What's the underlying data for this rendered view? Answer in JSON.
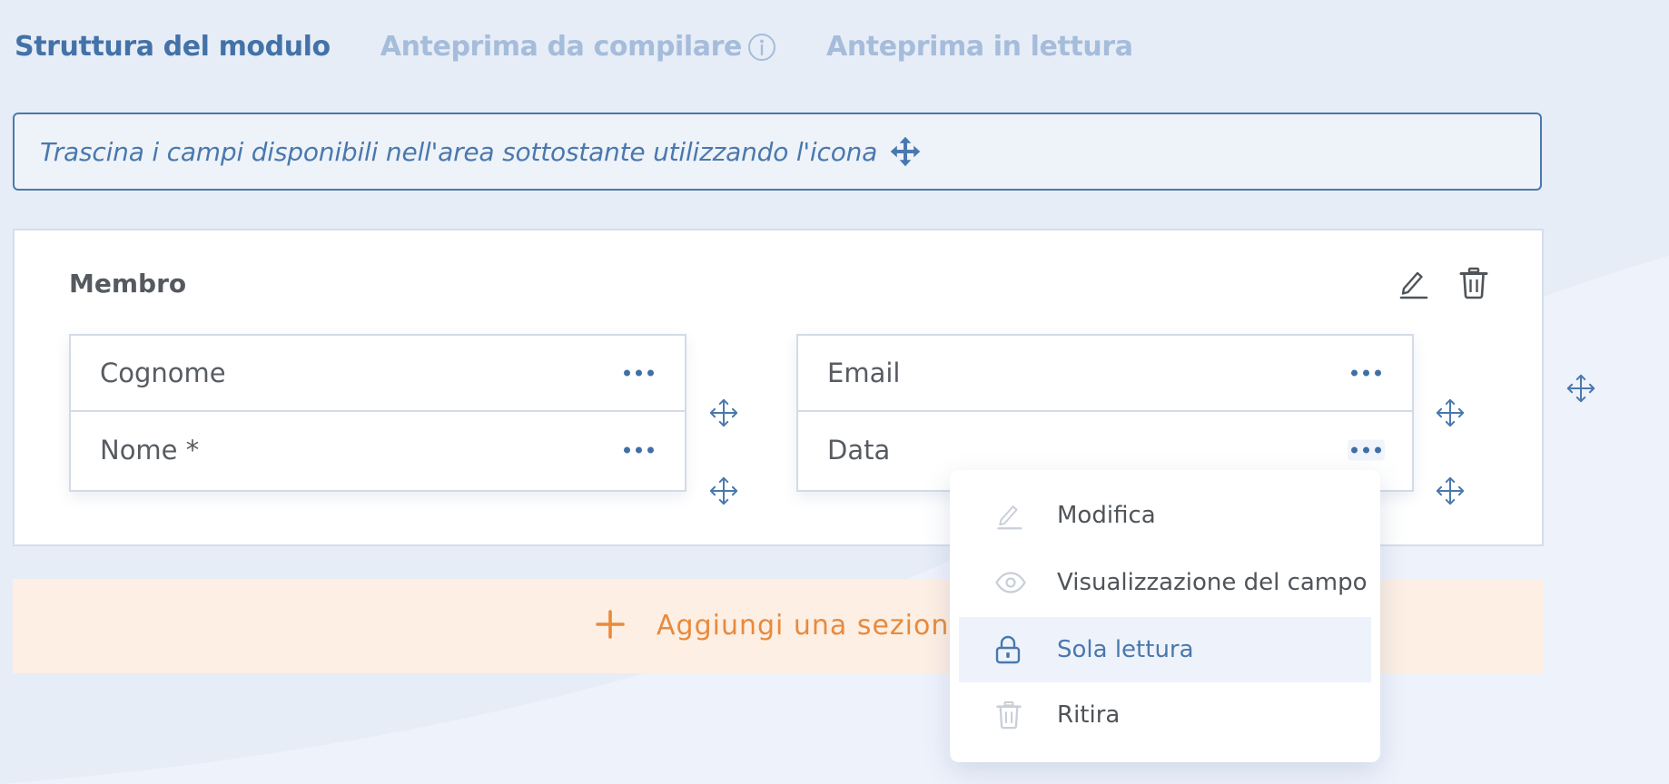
{
  "tabs": [
    {
      "label": "Struttura del modulo",
      "active": true
    },
    {
      "label": "Anteprima da compilare",
      "active": false
    },
    {
      "label": "Anteprima in lettura",
      "active": false
    }
  ],
  "hint": {
    "text": "Trascina i campi disponibili nell'area sottostante utilizzando l'icona",
    "icon": "move-icon"
  },
  "section": {
    "title": "Membro",
    "actions": [
      {
        "icon": "pencil-icon"
      },
      {
        "icon": "trash-icon"
      }
    ],
    "columns": [
      {
        "fields": [
          {
            "label": "Cognome"
          },
          {
            "label": "Nome *"
          }
        ]
      },
      {
        "fields": [
          {
            "label": "Email"
          },
          {
            "label": "Data"
          }
        ]
      }
    ]
  },
  "add_section": {
    "label": "Aggiungi una sezione",
    "icon": "plus-icon"
  },
  "context_menu": {
    "items": [
      {
        "label": "Modifica",
        "icon": "pencil-icon"
      },
      {
        "label": "Visualizzazione del campo",
        "icon": "eye-icon"
      },
      {
        "label": "Sola lettura",
        "icon": "lock-icon",
        "selected": true
      },
      {
        "label": "Ritira",
        "icon": "trash-icon"
      }
    ]
  },
  "colors": {
    "primary": "#4a78ad",
    "tab_inactive": "#a5bcdb",
    "accent_orange": "#e88a3d",
    "add_bg": "#fdefe3",
    "page_bg": "#e6edf7"
  }
}
